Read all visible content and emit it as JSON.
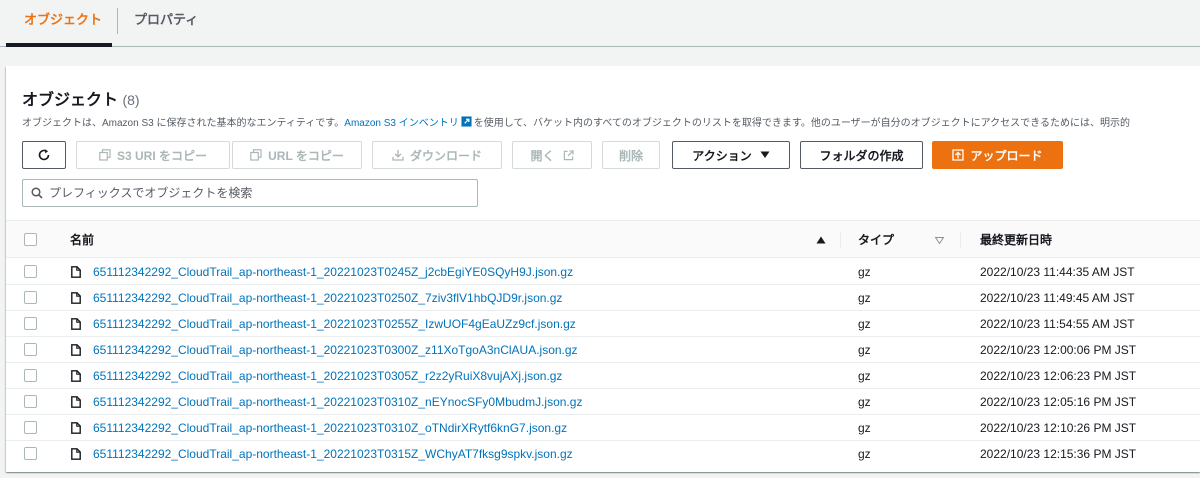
{
  "tabs": [
    {
      "label": "オブジェクト",
      "active": true
    },
    {
      "label": "プロパティ",
      "active": false
    }
  ],
  "panel": {
    "title": "オブジェクト",
    "count": "(8)",
    "description_before": "オブジェクトは、Amazon S3 に保存された基本的なエンティティです。",
    "description_link": "Amazon S3 インベントリ",
    "description_after": "を使用して、バケット内のすべてのオブジェクトのリストを取得できます。他のユーザーが自分のオブジェクトにアクセスできるためには、明示的"
  },
  "toolbar": {
    "refresh_icon": "refresh-icon",
    "copy_s3_uri": "S3 URI をコピー",
    "copy_url": "URL をコピー",
    "download": "ダウンロード",
    "open": "開く",
    "delete": "削除",
    "actions": "アクション",
    "create_folder": "フォルダの作成",
    "upload": "アップロード"
  },
  "search": {
    "placeholder": "プレフィックスでオブジェクトを検索",
    "value": ""
  },
  "table": {
    "columns": {
      "name": "名前",
      "type": "タイプ",
      "modified": "最終更新日時"
    },
    "rows": [
      {
        "name": "651112342292_CloudTrail_ap-northeast-1_20221023T0245Z_j2cbEgiYE0SQyH9J.json.gz",
        "type": "gz",
        "modified": "2022/10/23 11:44:35 AM JST"
      },
      {
        "name": "651112342292_CloudTrail_ap-northeast-1_20221023T0250Z_7ziv3flV1hbQJD9r.json.gz",
        "type": "gz",
        "modified": "2022/10/23 11:49:45 AM JST"
      },
      {
        "name": "651112342292_CloudTrail_ap-northeast-1_20221023T0255Z_IzwUOF4gEaUZz9cf.json.gz",
        "type": "gz",
        "modified": "2022/10/23 11:54:55 AM JST"
      },
      {
        "name": "651112342292_CloudTrail_ap-northeast-1_20221023T0300Z_z11XoTgoA3nClAUA.json.gz",
        "type": "gz",
        "modified": "2022/10/23 12:00:06 PM JST"
      },
      {
        "name": "651112342292_CloudTrail_ap-northeast-1_20221023T0305Z_r2z2yRuiX8vujAXj.json.gz",
        "type": "gz",
        "modified": "2022/10/23 12:06:23 PM JST"
      },
      {
        "name": "651112342292_CloudTrail_ap-northeast-1_20221023T0310Z_nEYnocSFy0MbudmJ.json.gz",
        "type": "gz",
        "modified": "2022/10/23 12:05:16 PM JST"
      },
      {
        "name": "651112342292_CloudTrail_ap-northeast-1_20221023T0310Z_oTNdirXRytf6knG7.json.gz",
        "type": "gz",
        "modified": "2022/10/23 12:10:26 PM JST"
      },
      {
        "name": "651112342292_CloudTrail_ap-northeast-1_20221023T0315Z_WChyAT7fksg9spkv.json.gz",
        "type": "gz",
        "modified": "2022/10/23 12:15:36 PM JST"
      }
    ]
  },
  "colors": {
    "accent": "#ec7211",
    "link": "#0073bb",
    "text": "#16191f"
  }
}
